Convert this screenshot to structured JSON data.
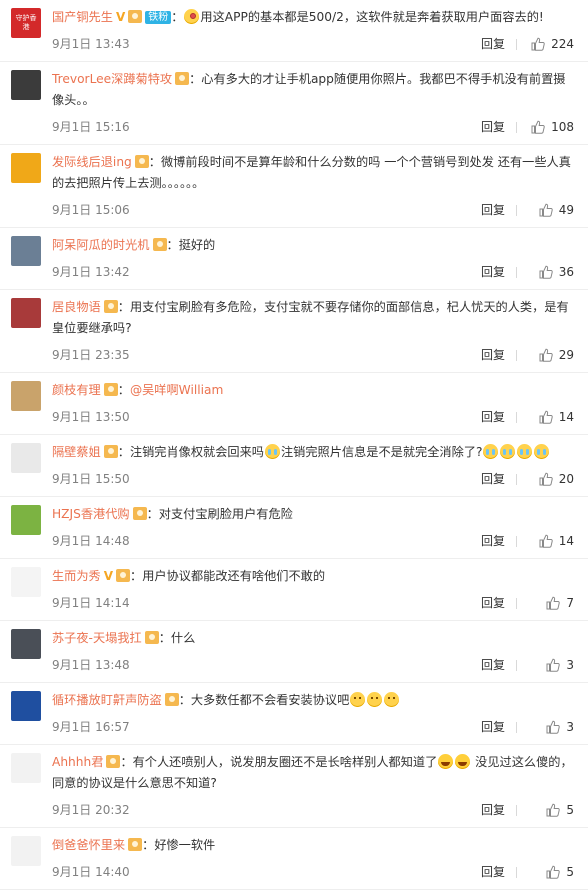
{
  "labels": {
    "reply": "回复"
  },
  "colors": {
    "username": "#eb7350",
    "meta": "#808080",
    "text": "#333333",
    "divider": "#eeeeee",
    "fan_badge": "#2fb3e5"
  },
  "comments": [
    {
      "user": "国产铜先生",
      "avatar_text": "守护香港",
      "avatar_color": "#d3292a",
      "v": "V",
      "fan_badge": "铁粉",
      "segments": [
        {
          "t": "icon",
          "name": "bulb-face-icon"
        },
        {
          "t": "text",
          "v": "用这APP的基本都是500/2，这软件就是奔着获取用户面容去的!"
        }
      ],
      "time": "9月1日 13:43",
      "likes": "224"
    },
    {
      "user": "TrevorLee深蹲菊特攻",
      "avatar_color": "#3b3b3b",
      "segments": [
        {
          "t": "text",
          "v": "心有多大的才让手机app随便用你照片。我都巴不得手机没有前置摄像头。。"
        }
      ],
      "time": "9月1日 15:16",
      "likes": "108"
    },
    {
      "user": "发际线后退ing",
      "avatar_color": "#f0a818",
      "segments": [
        {
          "t": "text",
          "v": "微博前段时间不是算年龄和什么分数的吗  一个个营销号到处发  还有一些人真的去把照片传上去测。。。。。。"
        }
      ],
      "time": "9月1日 15:06",
      "likes": "49"
    },
    {
      "user": "阿呆阿瓜的时光机",
      "avatar_color": "#6b7f95",
      "segments": [
        {
          "t": "text",
          "v": "挺好的"
        }
      ],
      "time": "9月1日 13:42",
      "likes": "36"
    },
    {
      "user": "居良物语",
      "avatar_color": "#a83a3a",
      "segments": [
        {
          "t": "text",
          "v": "用支付宝刷脸有多危险，支付宝就不要存储你的面部信息，杞人忧天的人类，是有皇位要继承吗?"
        }
      ],
      "time": "9月1日 23:35",
      "likes": "29"
    },
    {
      "user": "颜枝有理",
      "avatar_color": "#c9a36b",
      "segments": [
        {
          "t": "mention",
          "v": "@吴咩啊William"
        }
      ],
      "time": "9月1日 13:50",
      "likes": "14"
    },
    {
      "user": "隔壁蔡姐",
      "avatar_color": "#e9e9e9",
      "segments": [
        {
          "t": "text",
          "v": "注销完肖像权就会回来吗"
        },
        {
          "t": "icon",
          "name": "crying-emoji-icon"
        },
        {
          "t": "text",
          "v": "注销完照片信息是不是就完全消除了?"
        },
        {
          "t": "icon",
          "name": "crying-emoji-icon"
        },
        {
          "t": "icon",
          "name": "crying-emoji-icon"
        },
        {
          "t": "icon",
          "name": "crying-emoji-icon"
        },
        {
          "t": "icon",
          "name": "crying-emoji-icon"
        }
      ],
      "time": "9月1日 15:50",
      "likes": "20"
    },
    {
      "user": "HZJS香港代购",
      "avatar_color": "#7cb342",
      "segments": [
        {
          "t": "text",
          "v": "对支付宝刷脸用户有危险"
        }
      ],
      "time": "9月1日 14:48",
      "likes": "14"
    },
    {
      "user": "生而为秀",
      "avatar_color": "#f4f4f4",
      "v": "V",
      "segments": [
        {
          "t": "text",
          "v": "用户协议都能改还有啥他们不敢的"
        }
      ],
      "time": "9月1日 14:14",
      "likes": "7"
    },
    {
      "user": "苏子夜-天塌我扛",
      "avatar_color": "#4a4f57",
      "segments": [
        {
          "t": "text",
          "v": "什么"
        }
      ],
      "time": "9月1日 13:48",
      "likes": "3"
    },
    {
      "user": "循环播放盯鼾声防盗",
      "avatar_color": "#1f4fa0",
      "segments": [
        {
          "t": "text",
          "v": "大多数任都不会看安装协议吧"
        },
        {
          "t": "icon",
          "name": "speechless-emoji-icon"
        },
        {
          "t": "icon",
          "name": "speechless-emoji-icon"
        },
        {
          "t": "icon",
          "name": "speechless-emoji-icon"
        }
      ],
      "time": "9月1日 16:57",
      "likes": "3"
    },
    {
      "user": "Ahhhh君",
      "avatar_color": "#f2f2f2",
      "segments": [
        {
          "t": "text",
          "v": "有个人还喷别人，说发朋友圈还不是长啥样别人都知道了"
        },
        {
          "t": "icon",
          "name": "laughing-crying-emoji-icon"
        },
        {
          "t": "icon",
          "name": "laughing-crying-emoji-icon"
        },
        {
          "t": "text",
          "v": " 没见过这么傻的，同意的协议是什么意思不知道?"
        }
      ],
      "time": "9月1日 20:32",
      "likes": "5"
    },
    {
      "user": "倒爸爸怀里来",
      "avatar_color": "#f2f2f2",
      "segments": [
        {
          "t": "text",
          "v": "好惨一软件"
        }
      ],
      "time": "9月1日 14:40",
      "likes": "5"
    }
  ]
}
